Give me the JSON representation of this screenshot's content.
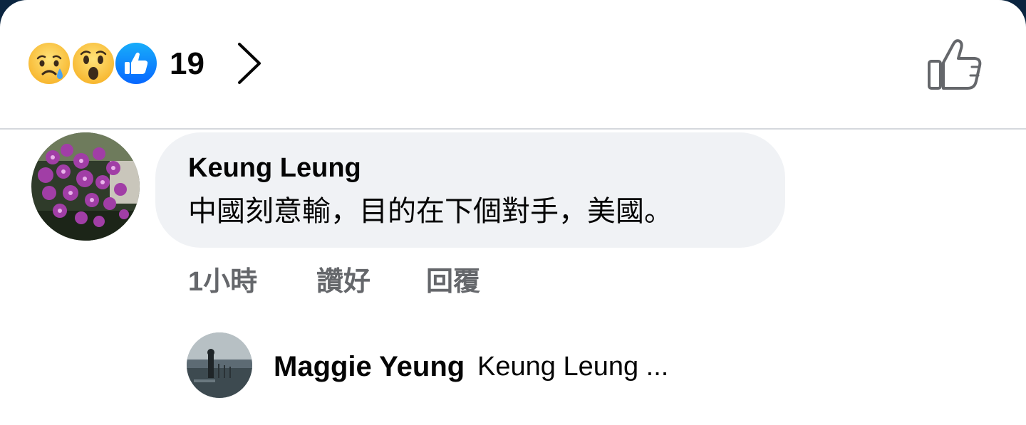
{
  "reactions": {
    "icons": [
      "sad-reaction-icon",
      "wow-reaction-icon",
      "like-reaction-icon"
    ],
    "count": "19",
    "chevron_icon": "chevron-right-icon",
    "like_button_icon": "thumbs-up-outline-icon"
  },
  "comment": {
    "author": "Keung Leung",
    "text": "中國刻意輸，目的在下個對手，美國。",
    "time": "1小時",
    "like_label": "讚好",
    "reply_label": "回覆"
  },
  "reply_preview": {
    "author": "Maggie Yeung",
    "text": "Keung Leung ..."
  },
  "colors": {
    "background_top": "#0b2540",
    "sheet": "#ffffff",
    "bubble": "#f0f2f5",
    "secondary_text": "#65676b",
    "like_blue": "#1877f2",
    "reaction_yellow": "#fcc93a"
  }
}
